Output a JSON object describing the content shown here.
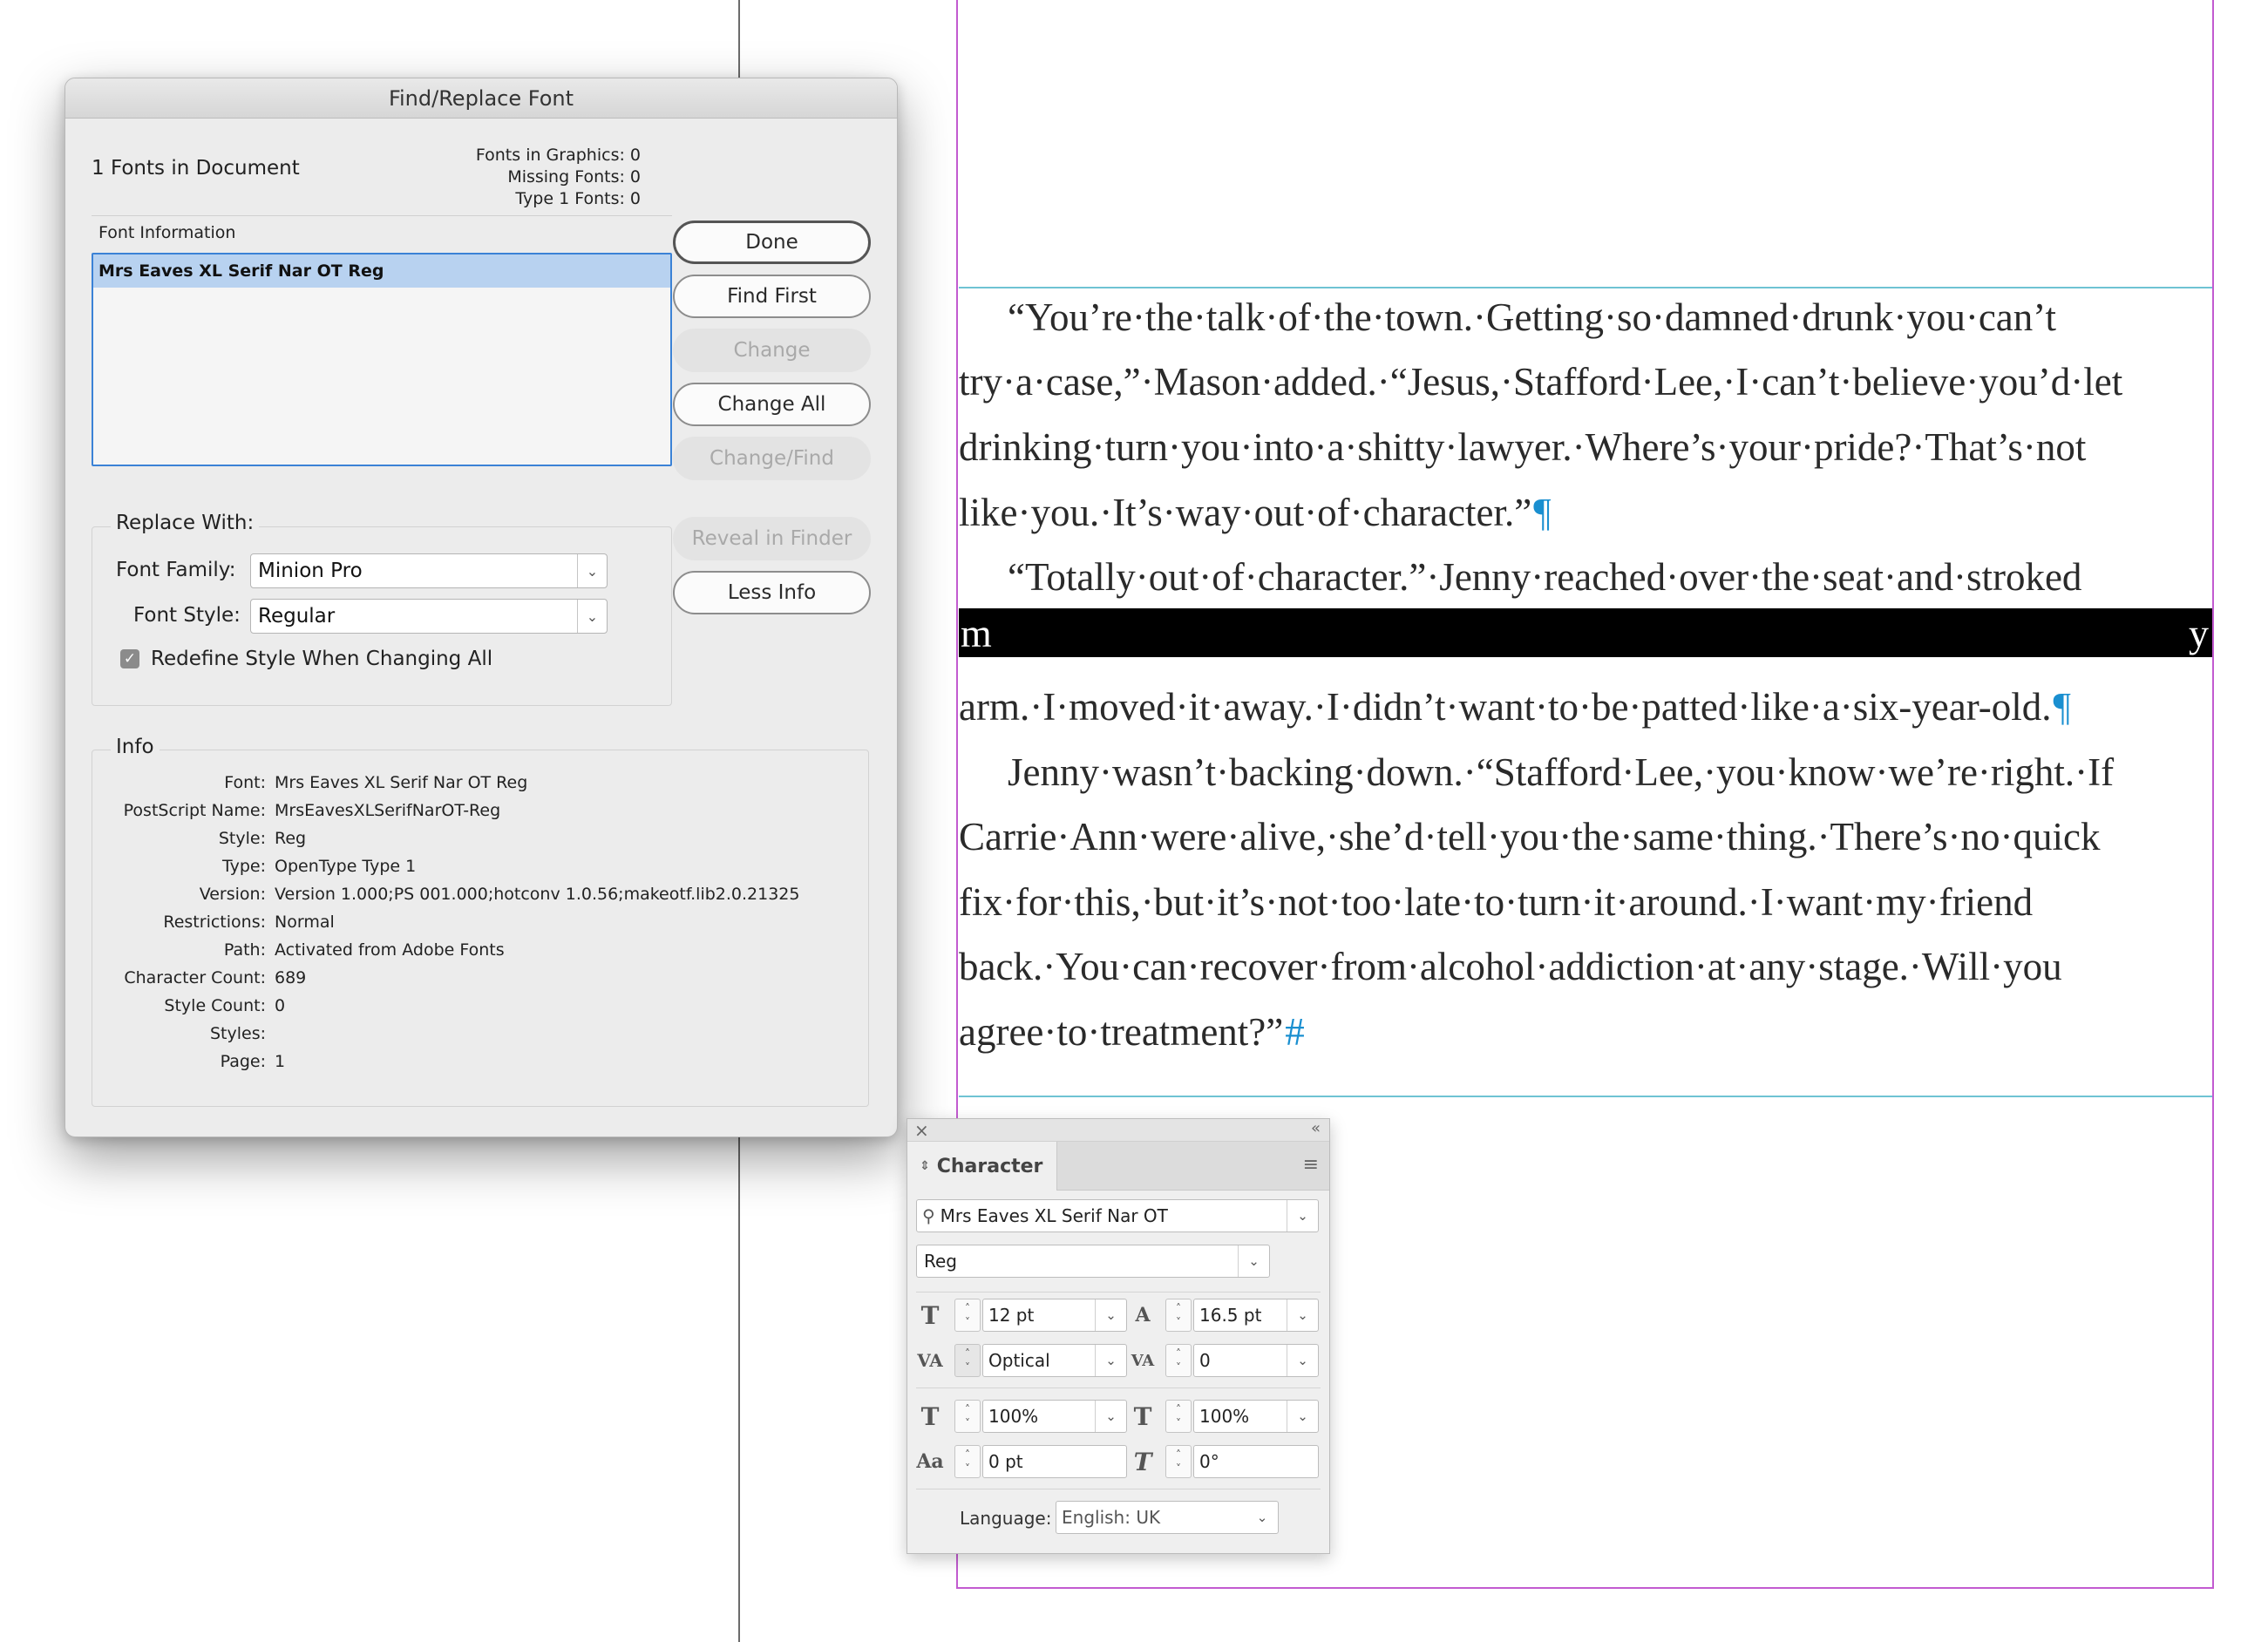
{
  "document": {
    "lines": [
      "“You’re·the·talk·of·the·town.·Getting·so·damned·drunk·you·can’t",
      "try·a·case,”·Mason·added.·“Jesus,·Stafford·Lee,·I·can’t·believe·you’d·let",
      "drinking·turn·you·into·a·shitty·lawyer.·Where’s·your·pride?·That’s·not",
      "like·you.·It’s·way·out·of·character.”",
      "“Totally·out·of·character.”·Jenny·reached·over·the·seat·and·stroked",
      "arm.·I·moved·it·away.·I·didn’t·want·to·be·patted·like·a·six-year-old.",
      "Jenny·wasn’t·backing·down.·“Stafford·Lee,·you·know·we’re·right.·If",
      "Carrie·Ann·were·alive,·she’d·tell·you·the·same·thing.·There’s·no·quick",
      "fix·for·this,·but·it’s·not·too·late·to·turn·it·around.·I·want·my·friend",
      "back.·You·can·recover·from·alcohol·addiction·at·any·stage.·Will·you",
      "agree·to·treatment?”"
    ],
    "pilcrow": "¶",
    "end_of_story": "#",
    "overset_left": "m",
    "overset_right": "y"
  },
  "dialog": {
    "title": "Find/Replace Font",
    "fonts_in_document": "1 Fonts in Document",
    "stats": [
      "Fonts in Graphics: 0",
      "Missing Fonts: 0",
      "Type 1 Fonts: 0"
    ],
    "font_information_label": "Font Information",
    "font_list": [
      "Mrs Eaves XL Serif Nar OT Reg"
    ],
    "buttons": {
      "done": "Done",
      "find_first": "Find First",
      "change": "Change",
      "change_all": "Change All",
      "change_find": "Change/Find",
      "reveal_in_finder": "Reveal in Finder",
      "less_info": "Less Info"
    },
    "replace_with": {
      "label": "Replace With:",
      "font_family_label": "Font Family:",
      "font_family_value": "Minion Pro",
      "font_style_label": "Font Style:",
      "font_style_value": "Regular",
      "redefine_label": "Redefine Style When Changing All",
      "redefine_checked": true
    },
    "info": {
      "label": "Info",
      "rows": [
        {
          "key": "Font:",
          "value": "Mrs Eaves XL Serif Nar OT Reg"
        },
        {
          "key": "PostScript Name:",
          "value": "MrsEavesXLSerifNarOT-Reg"
        },
        {
          "key": "Style:",
          "value": "Reg"
        },
        {
          "key": "Type:",
          "value": "OpenType Type 1"
        },
        {
          "key": "Version:",
          "value": "Version 1.000;PS 001.000;hotconv 1.0.56;makeotf.lib2.0.21325"
        },
        {
          "key": "Restrictions:",
          "value": "Normal"
        },
        {
          "key": "Path:",
          "value": "Activated from Adobe Fonts"
        },
        {
          "key": "Character Count:",
          "value": "689"
        },
        {
          "key": "Style Count:",
          "value": "0"
        },
        {
          "key": "Styles:",
          "value": ""
        },
        {
          "key": "Page:",
          "value": "1"
        }
      ]
    }
  },
  "character_panel": {
    "tab_label": "Character",
    "font_family": "Mrs Eaves XL Serif Nar OT",
    "font_style": "Reg",
    "font_size": "12 pt",
    "leading": "16.5 pt",
    "kerning": "Optical",
    "tracking": "0",
    "vertical_scale": "100%",
    "horizontal_scale": "100%",
    "baseline_shift": "0 pt",
    "skew": "0°",
    "language_label": "Language:",
    "language_value": "English: UK"
  },
  "colors": {
    "selection": "#b8d2f0",
    "focus_ring": "#3b82d6",
    "margin_guide": "#c25bd0",
    "frame_edge": "#6fc3d3",
    "hidden_chars": "#1a8fd0"
  }
}
